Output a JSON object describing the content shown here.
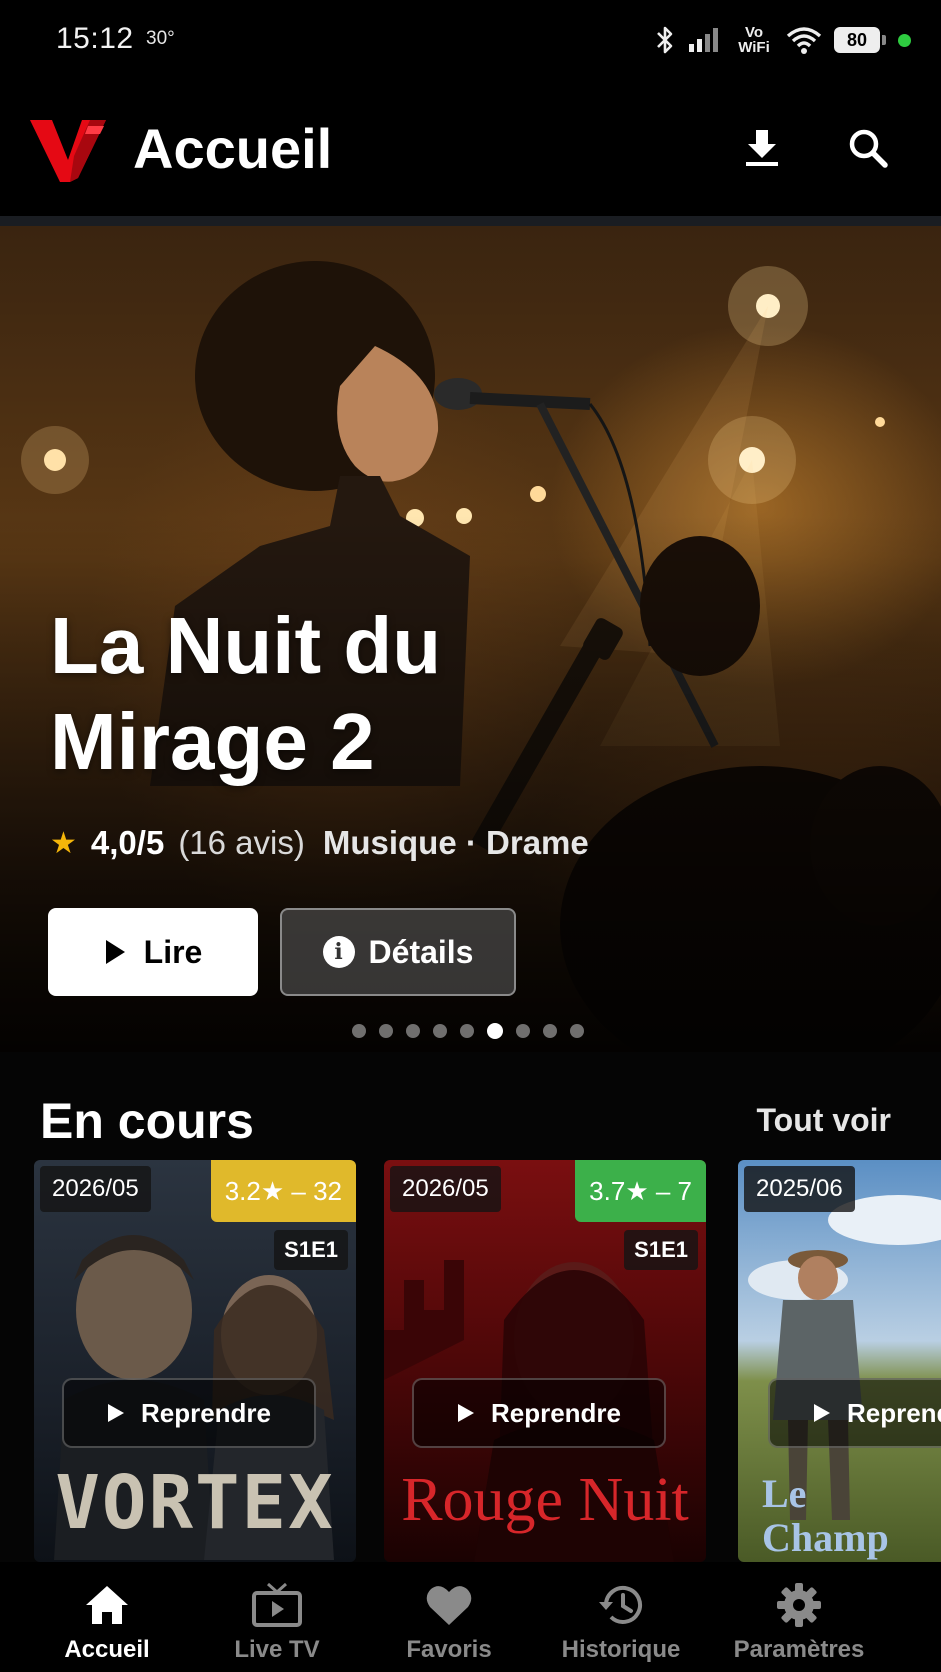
{
  "status_bar": {
    "time": "15:12",
    "temperature": "30°",
    "network": "Vo WiFi",
    "battery": "80"
  },
  "app_bar": {
    "title": "Accueil",
    "download_icon": "download-icon",
    "search_icon": "search-icon",
    "brand_color": "#e50914"
  },
  "hero": {
    "title": "La Nuit du Mirage 2",
    "rating": "4,0/5",
    "reviews": "(16 avis)",
    "genres": "Musique · Drame",
    "play_label": "Lire",
    "details_label": "Détails",
    "carousel": {
      "count": 9,
      "active_index": 5
    }
  },
  "continue_watching": {
    "title": "En cours",
    "see_all": "Tout voir",
    "items": [
      {
        "date": "2026/05",
        "score": "3.2★ – 32",
        "score_color": "#e0b92b",
        "episode": "S1E1",
        "resume": "Reprendre",
        "poster_title": "VORTEX"
      },
      {
        "date": "2026/05",
        "score": "3.7★ – 7",
        "score_color": "#3cb04a",
        "episode": "S1E1",
        "resume": "Reprendre",
        "poster_title": "Rouge Nuit"
      },
      {
        "date": "2025/06",
        "score": "",
        "score_color": "",
        "episode": "",
        "resume": "Reprendre",
        "poster_title": "Le Champ Bleu"
      }
    ]
  },
  "bottom_nav": {
    "items": [
      {
        "label": "Accueil",
        "icon": "home-icon",
        "active": true
      },
      {
        "label": "Live TV",
        "icon": "tv-icon",
        "active": false
      },
      {
        "label": "Favoris",
        "icon": "heart-icon",
        "active": false
      },
      {
        "label": "Historique",
        "icon": "history-icon",
        "active": false
      },
      {
        "label": "Paramètres",
        "icon": "gear-icon",
        "active": false
      }
    ]
  }
}
